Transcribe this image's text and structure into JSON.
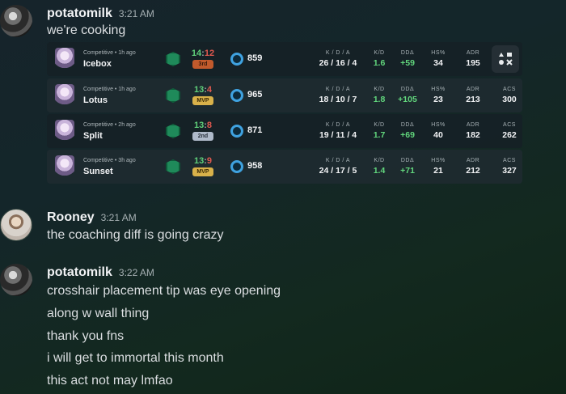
{
  "messages": [
    {
      "username": "potatomilk",
      "timestamp": "3:21 AM",
      "lines": [
        "we're cooking"
      ],
      "matches": [
        {
          "meta": "Competitive • 1h ago",
          "map": "Icebox",
          "won": "14",
          "lost": "12",
          "badge": "3rd",
          "badge_style": "b3",
          "rr": "859",
          "kda": "26 / 16 / 4",
          "kd": "1.6",
          "dd": "+59",
          "hs": "34",
          "adr": "195",
          "acs": "",
          "show_acs": false
        },
        {
          "meta": "Competitive • 1h ago",
          "map": "Lotus",
          "won": "13",
          "lost": "4",
          "badge": "MVP",
          "badge_style": "mvp",
          "rr": "965",
          "kda": "18 / 10 / 7",
          "kd": "1.8",
          "dd": "+105",
          "hs": "23",
          "adr": "213",
          "acs": "300",
          "show_acs": true
        },
        {
          "meta": "Competitive • 2h ago",
          "map": "Split",
          "won": "13",
          "lost": "8",
          "badge": "2nd",
          "badge_style": "b2",
          "rr": "871",
          "kda": "19 / 11 / 4",
          "kd": "1.7",
          "dd": "+69",
          "hs": "40",
          "adr": "182",
          "acs": "262",
          "show_acs": true
        },
        {
          "meta": "Competitive • 3h ago",
          "map": "Sunset",
          "won": "13",
          "lost": "9",
          "badge": "MVP",
          "badge_style": "mvp",
          "rr": "958",
          "kda": "24 / 17 / 5",
          "kd": "1.4",
          "dd": "+71",
          "hs": "21",
          "adr": "212",
          "acs": "327",
          "show_acs": true
        }
      ]
    },
    {
      "username": "Rooney",
      "timestamp": "3:21 AM",
      "lines": [
        "the coaching diff is going crazy"
      ]
    },
    {
      "username": "potatomilk",
      "timestamp": "3:22 AM",
      "lines": [
        "crosshair placement tip was eye opening",
        "along w wall thing",
        "thank you fns",
        "i will get to immortal this month",
        "this act not may lmfao"
      ]
    }
  ],
  "stat_labels": {
    "kda": "K / D / A",
    "kd": "K/D",
    "dd": "DDΔ",
    "hs": "HS%",
    "adr": "ADR",
    "acs": "ACS"
  },
  "embed_button_icon": "game-controller-icon",
  "colors": {
    "win": "#5fd07a",
    "loss": "#e0594f",
    "positive": "#62d77d",
    "rr_ring": "#3fa2e0",
    "badge_mvp": "#d9b14a"
  }
}
